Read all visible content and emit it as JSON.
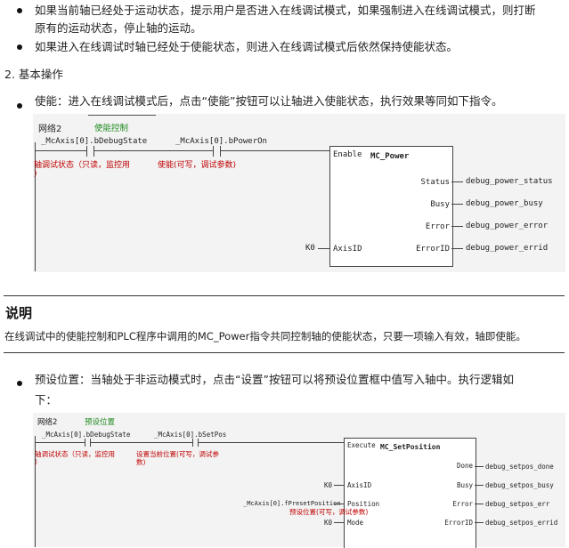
{
  "bullets_top": [
    "如果当前轴已经处于运动状态，提示用户是否进入在线调试模式，如果强制进入在线调试模式，则打断",
    "原有的运动状态，停止轴的运动。",
    "如果进入在线调试时轴已经处于使能状态，则进入在线调试模式后依然保持使能状态。"
  ],
  "section_heading": "2. 基本操作",
  "bullet_enable": "使能：进入在线调试模式后，点击“使能”按钮可以让轴进入使能状态，执行效果等同如下指令。",
  "network1": {
    "network_label": "网络2",
    "network_comment": "使能控制",
    "contact1_var": "_McAxis[0].bDebugState",
    "contact1_comment": "轴调试状态（只读，监控用",
    "contact1_comment_cont": "）",
    "contact2_var": "_McAxis[0].bPowerOn",
    "contact2_comment": "使能(可写，调试参数)",
    "fb_name": "MC_Power",
    "input_enable": "Enable",
    "input_axis": "AxisID",
    "axis_value": "K0",
    "outputs": [
      {
        "pin": "Status",
        "var": "debug_power_status"
      },
      {
        "pin": "Busy",
        "var": "debug_power_busy"
      },
      {
        "pin": "Error",
        "var": "debug_power_error"
      },
      {
        "pin": "ErrorID",
        "var": "debug_power_errid"
      }
    ]
  },
  "note": {
    "title": "说明",
    "body": "在线调试中的使能控制和PLC程序中调用的MC_Power指令共同控制轴的使能状态，只要一项输入有效，轴即使能。"
  },
  "bullet_setpos": "预设位置：当轴处于非运动模式时，点击“设置”按钮可以将预设位置框中值写入轴中。执行逻辑如",
  "bullet_setpos_cont": "下：",
  "network2": {
    "network_label": "网络2",
    "network_comment": "预设位置",
    "contact1_var": "_McAxis[0].bDebugState",
    "contact1_comment": "轴调试状态（只读，监控用",
    "contact1_comment_cont": "）",
    "contact2_var": "_McAxis[0].bSetPos",
    "contact2_comment": "设置当前位置(可写，调试参",
    "contact2_comment_cont": "数)",
    "fb_name": "MC_SetPosition",
    "input_execute": "Execute",
    "input_axis": "AxisID",
    "axis_value": "K0",
    "input_position": "Position",
    "position_var": "_McAxis[0].fPresetPosition",
    "position_comment": "预设位置(可写，调试参数)",
    "input_mode": "Mode",
    "mode_value": "K0",
    "outputs": [
      {
        "pin": "Done",
        "var": "debug_setpos_done"
      },
      {
        "pin": "Busy",
        "var": "debug_setpos_busy"
      },
      {
        "pin": "Error",
        "var": "debug_setpos_err"
      },
      {
        "pin": "ErrorID",
        "var": "debug_setpos_errid"
      }
    ]
  }
}
